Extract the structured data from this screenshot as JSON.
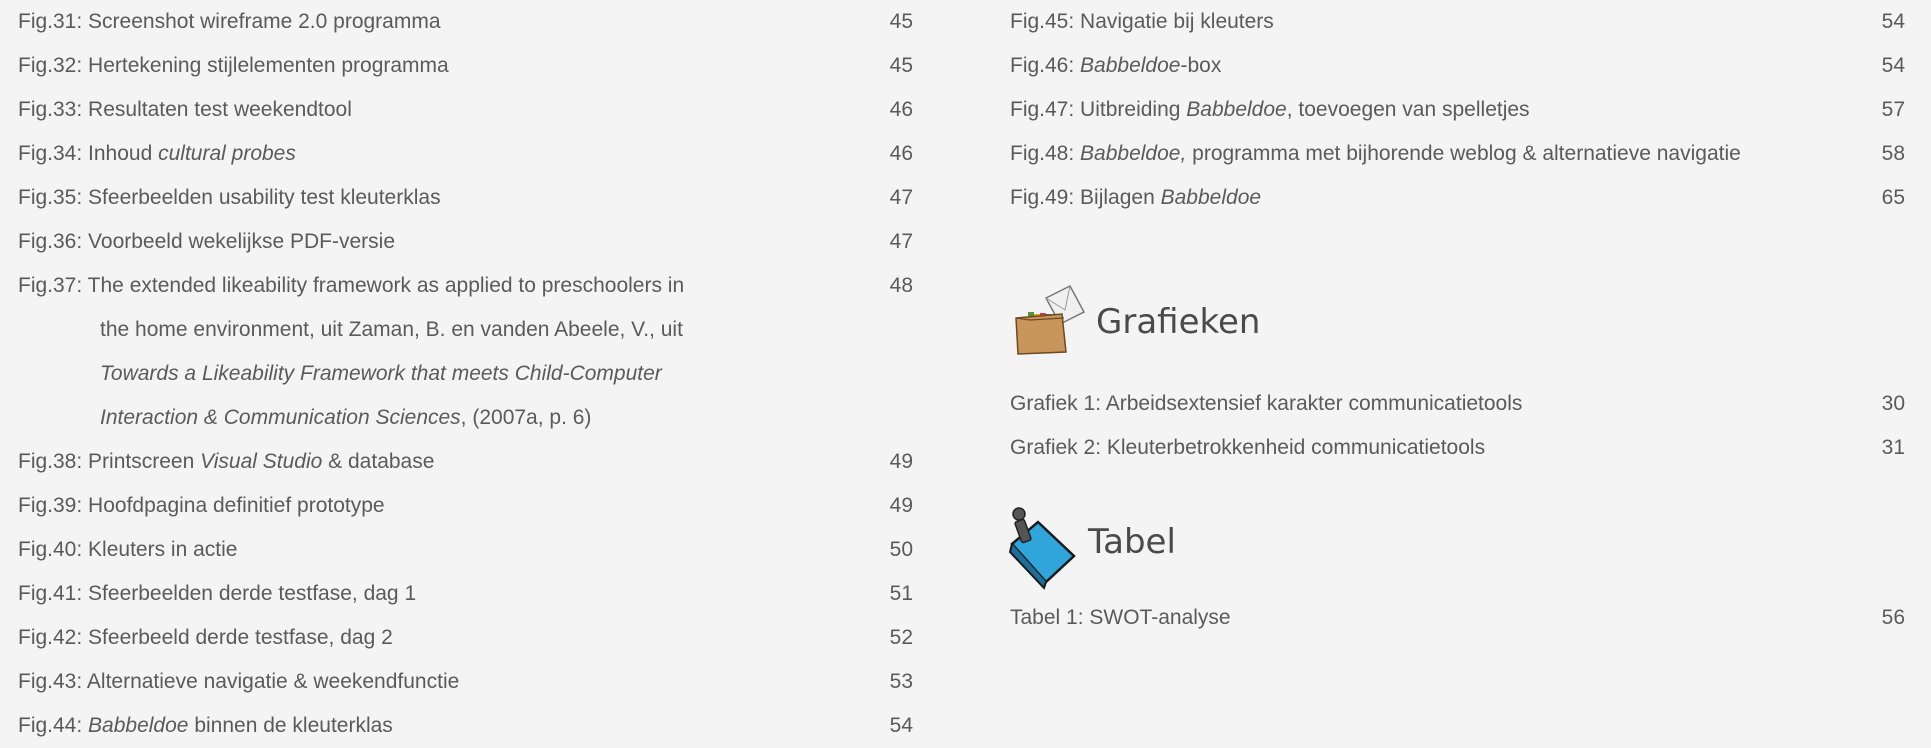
{
  "left_entries": [
    {
      "fig": "Fig.31:",
      "text": "Screenshot wireframe 2.0 programma",
      "page": "45"
    },
    {
      "fig": "Fig.32:",
      "text": "Hertekening stijlelementen programma",
      "page": "45"
    },
    {
      "fig": "Fig.33:",
      "text": "Resultaten test weekendtool",
      "page": "46"
    },
    {
      "fig": "Fig.34:",
      "text": "Inhoud",
      "italic": "cultural probes",
      "page": "46"
    },
    {
      "fig": "Fig.35:",
      "text": "Sfeerbeelden usability test kleuterklas",
      "page": "47"
    },
    {
      "fig": "Fig.36:",
      "text": "Voorbeeld wekelijkse PDF-versie",
      "page": "47"
    },
    {
      "fig": "Fig.37:",
      "text": "The extended likeability framework as applied to preschoolers in",
      "page": "48",
      "line2": "the home environment, uit Zaman, B. en vanden Abeele, V., uit",
      "line3": "Towards a Likeability Framework that meets Child-Computer",
      "line4_italic": "Interaction & Communication Sciences",
      "line4_rest": ", (2007a, p. 6)"
    },
    {
      "fig": "Fig.38:",
      "text": "Printscreen",
      "italic": "Visual Studio",
      "after": "& database",
      "page": "49"
    },
    {
      "fig": "Fig.39:",
      "text": "Hoofdpagina definitief prototype",
      "page": "49"
    },
    {
      "fig": "Fig.40:",
      "text": "Kleuters in actie",
      "page": "50"
    },
    {
      "fig": "Fig.41:",
      "text": "Sfeerbeelden derde testfase, dag 1",
      "page": "51"
    },
    {
      "fig": "Fig.42:",
      "text": "Sfeerbeeld derde testfase, dag 2",
      "page": "52"
    },
    {
      "fig": "Fig.43:",
      "text": "Alternatieve navigatie & weekendfunctie",
      "page": "53"
    },
    {
      "fig": "Fig.44:",
      "italic_first": "Babbeldoe",
      "text": "binnen de kleuterklas",
      "page": "54"
    }
  ],
  "right_entries": [
    {
      "fig": "Fig.45:",
      "text": "Navigatie bij kleuters",
      "page": "54"
    },
    {
      "fig": "Fig.46:",
      "italic": "Babbeldoe",
      "after": "-box",
      "page": "54"
    },
    {
      "fig": "Fig.47:",
      "text": "Uitbreiding",
      "italic": "Babbeldoe",
      "after": ", toevoegen van spelletjes",
      "page": "57"
    },
    {
      "fig": "Fig.48:",
      "italic": "Babbeldoe,",
      "after": "programma met bijhorende weblog & alternatieve navigatie",
      "page": "58"
    },
    {
      "fig": "Fig.49:",
      "text": "Bijlagen",
      "italic": "Babbeldoe",
      "page": "65"
    }
  ],
  "grafieken": {
    "title": "Grafieken",
    "icon": "folder-envelope-icon",
    "entries": [
      {
        "label": "Grafiek 1: Arbeidsextensief karakter communicatietools",
        "page": "30"
      },
      {
        "label": "Grafiek 2: Kleuterbetrokkenheid communicatietools",
        "page": "31"
      }
    ]
  },
  "tabel": {
    "title": "Tabel",
    "icon": "clipboard-clip-icon",
    "entries": [
      {
        "label": "Tabel 1: SWOT-analyse",
        "page": "56"
      }
    ]
  },
  "colors": {
    "text": "#5a5a5a",
    "background": "#f4f4f4",
    "clip_blue": "#2fa5dc"
  }
}
